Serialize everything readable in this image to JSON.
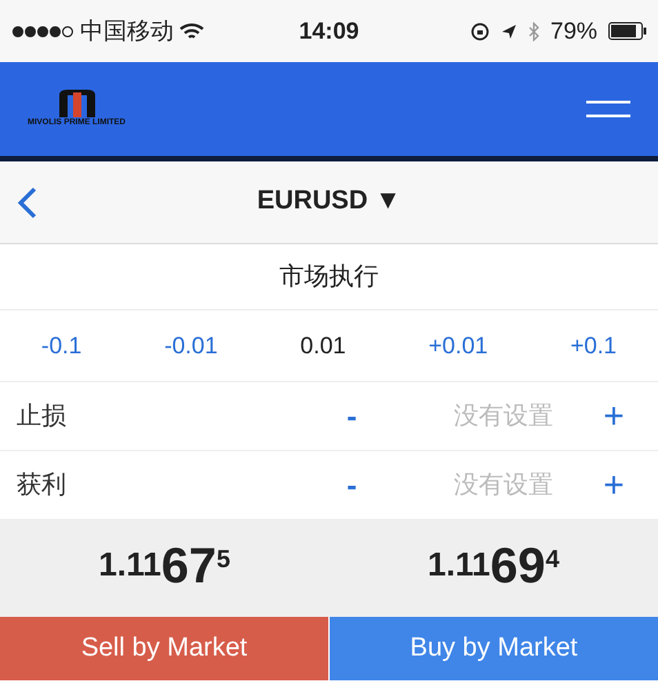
{
  "status_bar": {
    "carrier": "中国移动",
    "time": "14:09",
    "battery": "79%"
  },
  "header": {
    "logo_text": "MIVOLIS PRIME LIMITED"
  },
  "nav": {
    "symbol": "EURUSD",
    "caret": "▼"
  },
  "order_type": "市场执行",
  "volume": {
    "steps": [
      "-0.1",
      "-0.01"
    ],
    "value": "0.01",
    "steps_up": [
      "+0.01",
      "+0.1"
    ]
  },
  "levels": [
    {
      "label": "止损",
      "minus": "-",
      "value": "没有设置",
      "plus": "+"
    },
    {
      "label": "获利",
      "minus": "-",
      "value": "没有设置",
      "plus": "+"
    }
  ],
  "prices": [
    {
      "small": "1.11",
      "big": "67",
      "sup": "5"
    },
    {
      "small": "1.11",
      "big": "69",
      "sup": "4"
    }
  ],
  "buttons": [
    {
      "label": "Sell by Market",
      "kind": "sell"
    },
    {
      "label": "Buy by Market",
      "kind": "buy"
    }
  ]
}
